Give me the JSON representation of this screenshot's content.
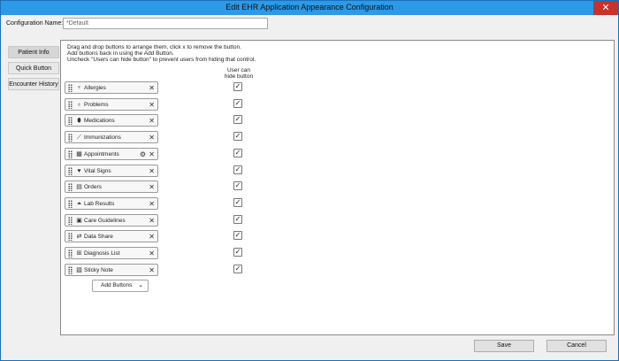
{
  "window": {
    "title": "Edit EHR Application Appearance Configuration",
    "close_glyph": "✕"
  },
  "config": {
    "label": "Configuration Name:",
    "value": "*Default"
  },
  "tabs": [
    {
      "label": "Patient Info"
    },
    {
      "label": "Quick Button"
    },
    {
      "label": "Encounter History"
    }
  ],
  "instructions": "Drag and drop buttons to arrange them, click x to remove the button.\nAdd buttons back in using the Add Button.\nUncheck \"Users can hide button\" to prevent users from hiding that control.",
  "hide_header": "User can\nhide button",
  "items": [
    {
      "label": "Allergies",
      "icon": "allergies-icon",
      "glyph": "♆",
      "checked": true
    },
    {
      "label": "Problems",
      "icon": "stethoscope-icon",
      "glyph": "♁",
      "checked": true
    },
    {
      "label": "Medications",
      "icon": "pill-icon",
      "glyph": "⬮",
      "checked": true
    },
    {
      "label": "Immunizations",
      "icon": "syringe-icon",
      "glyph": "⟋",
      "checked": true
    },
    {
      "label": "Appointments",
      "icon": "calendar-icon",
      "glyph": "▦",
      "checked": true
    },
    {
      "label": "Vital Signs",
      "icon": "heart-icon",
      "glyph": "♥",
      "checked": true
    },
    {
      "label": "Orders",
      "icon": "orders-icon",
      "glyph": "▤",
      "checked": true
    },
    {
      "label": "Lab Results",
      "icon": "flask-icon",
      "glyph": "⏶",
      "checked": true
    },
    {
      "label": "Care Guidelines",
      "icon": "guidelines-icon",
      "glyph": "▣",
      "checked": true
    },
    {
      "label": "Data Share",
      "icon": "data-share-icon",
      "glyph": "⇄",
      "checked": true
    },
    {
      "label": "Diagnosis List",
      "icon": "diagnosis-icon",
      "glyph": "⊞",
      "checked": true
    },
    {
      "label": "Sticky Note",
      "icon": "sticky-note-icon",
      "glyph": "▧",
      "checked": true
    }
  ],
  "remove_glyph": "✕",
  "gear_glyph": "⚙",
  "check_glyph": "✓",
  "add_button": {
    "label": "Add Buttons",
    "chevron": "⌄"
  },
  "footer": {
    "save": "Save",
    "cancel": "Cancel"
  },
  "colors": {
    "titlebar": "#2b9ae8",
    "close": "#c9312b"
  }
}
